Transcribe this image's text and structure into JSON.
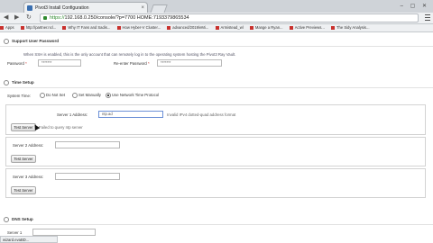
{
  "browser": {
    "tab_title": "Pivot3 Install Configuration",
    "tab_close": "×",
    "window_buttons": "– ▢ ✕",
    "back": "◀",
    "forward": "▶",
    "reload": "↻",
    "url_scheme": "https://",
    "url_rest": "192.168.0.250/console/?p=7700 HOME:7193379865534",
    "bookmarks": [
      "Apps",
      "http://partner.ncl...",
      "Why IT Fans and Sadis...",
      "How Hyber-V Cluster...",
      "advanced/2019/eMi...",
      "Armistead_wl",
      "Mange a Ryan...",
      "Active Previews...",
      "The Sidy Analysis..."
    ]
  },
  "support": {
    "title": "Support User Password",
    "description": "When SSH is enabled, this is the only account that can remotely log in to the operating system hosting the Pivot3 Ray Vault.",
    "password_label": "Password",
    "password_value": "*******",
    "reenter_label": "Re-enter Password",
    "reenter_value": "*******",
    "req": "*"
  },
  "time": {
    "title": "Time Setup",
    "system_time_label": "System Time:",
    "options": [
      "Do Not Set",
      "Set Manually",
      "Use Network Time Protocol"
    ],
    "selected_index": 2,
    "server1_label": "Server 1 Address:",
    "server1_value": "ntp.ad",
    "server1_hint": "Invalid IPv4 dotted-quad address format",
    "test_server_label": "Test Server",
    "test_hint": "Failed to query ntp server",
    "server2_label": "Server 2 Address:",
    "server3_label": "Server 3 Address:"
  },
  "dns": {
    "title": "DNS Setup",
    "server1_label": "Server 1"
  },
  "status_bar": "wizard.evaBD..."
}
